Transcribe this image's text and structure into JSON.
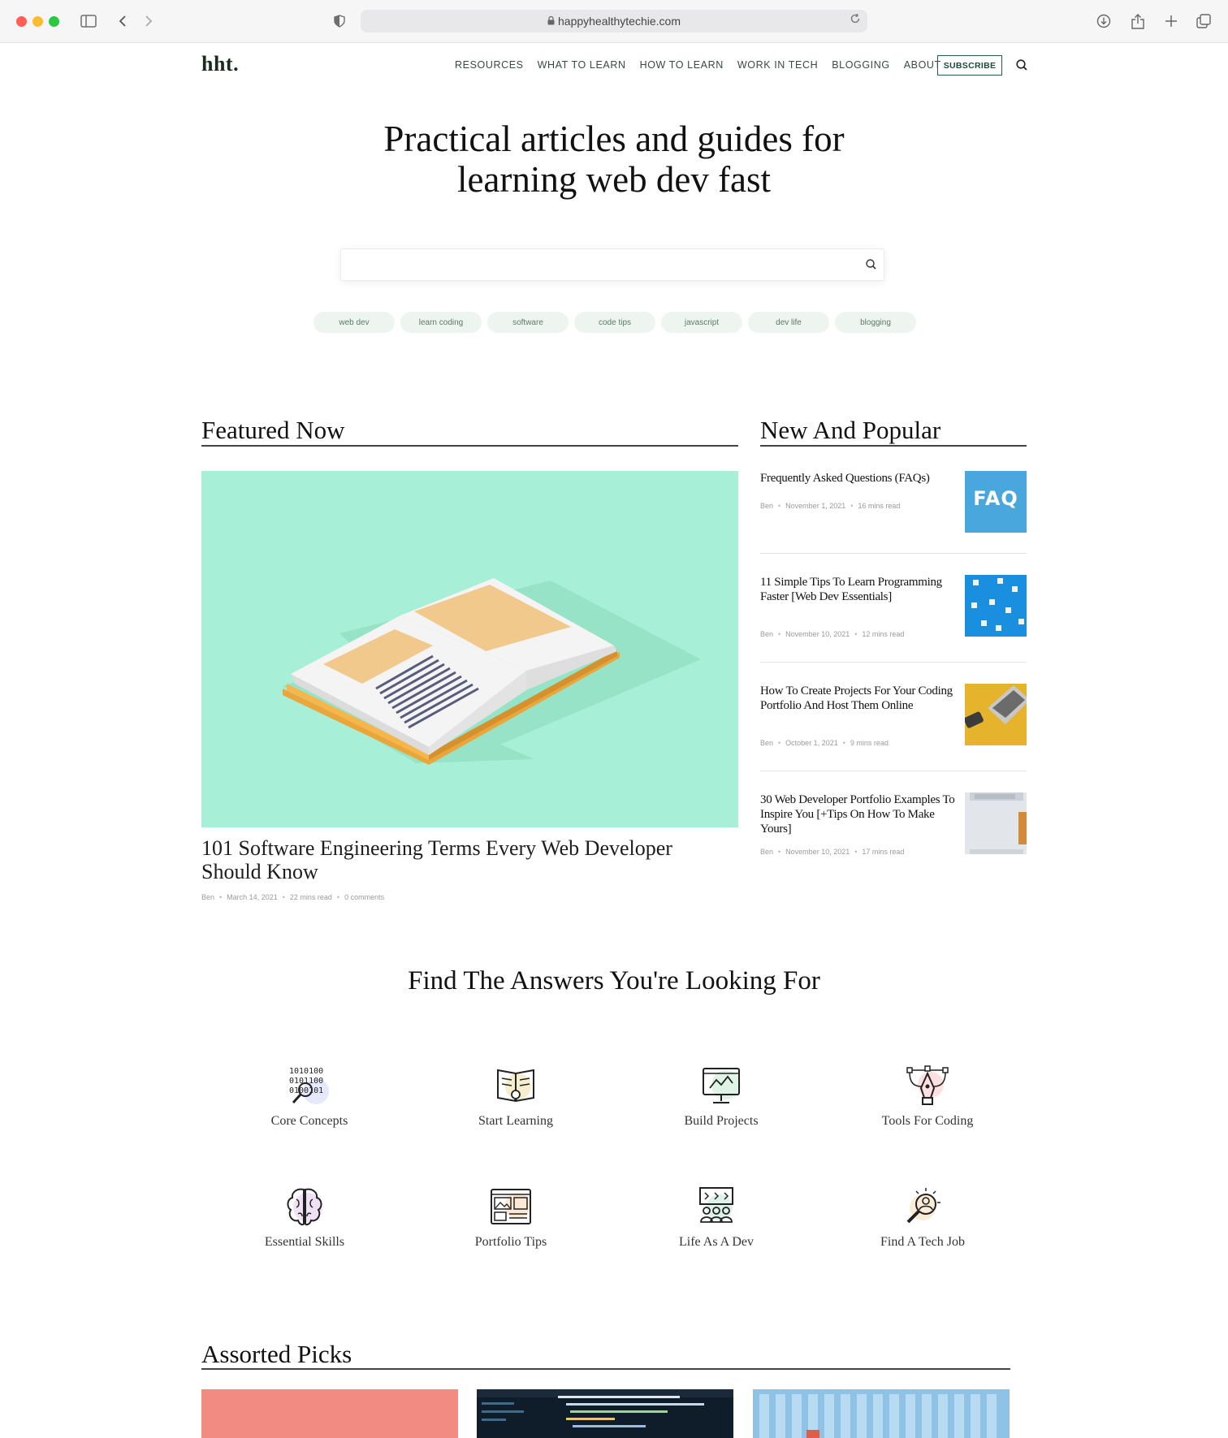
{
  "browser": {
    "url": "happyhealthytechie.com"
  },
  "site": {
    "logo": "hht.",
    "nav": [
      "RESOURCES",
      "WHAT TO LEARN",
      "HOW TO LEARN",
      "WORK IN TECH",
      "BLOGGING",
      "ABOUT"
    ],
    "subscribe_label": "SUBSCRIBE"
  },
  "hero": {
    "line1": "Practical articles and guides for",
    "line2": "learning web dev fast",
    "search_placeholder": ""
  },
  "tags": [
    "web dev",
    "learn coding",
    "software",
    "code tips",
    "javascript",
    "dev life",
    "blogging"
  ],
  "featured": {
    "heading": "Featured Now",
    "title": "101 Software Engineering Terms Every Web Developer Should Know",
    "author": "Ben",
    "date": "March 14, 2021",
    "read": "22 mins read",
    "comments": "0 comments"
  },
  "popular": {
    "heading": "New And Popular",
    "items": [
      {
        "title": "Frequently Asked Questions (FAQs)",
        "author": "Ben",
        "date": "November 1, 2021",
        "read": "16 mins read",
        "thumb_text": "FAQ"
      },
      {
        "title": "11 Simple Tips To Learn Programming Faster [Web Dev Essentials]",
        "author": "Ben",
        "date": "November 10, 2021",
        "read": "12 mins read"
      },
      {
        "title": "How To Create Projects For Your Coding Portfolio And Host Them Online",
        "author": "Ben",
        "date": "October 1, 2021",
        "read": "9 mins read"
      },
      {
        "title": "30 Web Developer Portfolio Examples To Inspire You [+Tips On How To Make Yours]",
        "author": "Ben",
        "date": "November 10, 2021",
        "read": "17 mins read"
      }
    ]
  },
  "answers": {
    "heading": "Find The Answers You're Looking For",
    "categories": [
      {
        "label": "Core Concepts",
        "icon": "binary-search-icon"
      },
      {
        "label": "Start Learning",
        "icon": "book-bulb-icon"
      },
      {
        "label": "Build Projects",
        "icon": "monitor-code-icon"
      },
      {
        "label": "Tools For Coding",
        "icon": "pen-tool-icon"
      },
      {
        "label": "Essential Skills",
        "icon": "brain-icon"
      },
      {
        "label": "Portfolio Tips",
        "icon": "portfolio-layout-icon"
      },
      {
        "label": "Life As A Dev",
        "icon": "team-chat-icon"
      },
      {
        "label": "Find A Tech Job",
        "icon": "job-search-icon"
      }
    ]
  },
  "assorted": {
    "heading": "Assorted Picks"
  },
  "colors": {
    "accent": "#2c5a47",
    "featured_bg": "#a8efd8",
    "tag_bg": "#eef5f0"
  }
}
